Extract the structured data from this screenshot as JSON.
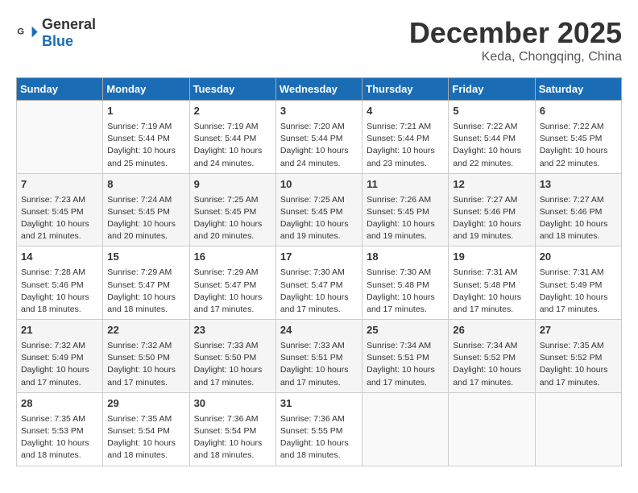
{
  "header": {
    "logo_general": "General",
    "logo_blue": "Blue",
    "month": "December 2025",
    "location": "Keda, Chongqing, China"
  },
  "columns": [
    "Sunday",
    "Monday",
    "Tuesday",
    "Wednesday",
    "Thursday",
    "Friday",
    "Saturday"
  ],
  "weeks": [
    [
      {
        "day": "",
        "info": ""
      },
      {
        "day": "1",
        "info": "Sunrise: 7:19 AM\nSunset: 5:44 PM\nDaylight: 10 hours\nand 25 minutes."
      },
      {
        "day": "2",
        "info": "Sunrise: 7:19 AM\nSunset: 5:44 PM\nDaylight: 10 hours\nand 24 minutes."
      },
      {
        "day": "3",
        "info": "Sunrise: 7:20 AM\nSunset: 5:44 PM\nDaylight: 10 hours\nand 24 minutes."
      },
      {
        "day": "4",
        "info": "Sunrise: 7:21 AM\nSunset: 5:44 PM\nDaylight: 10 hours\nand 23 minutes."
      },
      {
        "day": "5",
        "info": "Sunrise: 7:22 AM\nSunset: 5:44 PM\nDaylight: 10 hours\nand 22 minutes."
      },
      {
        "day": "6",
        "info": "Sunrise: 7:22 AM\nSunset: 5:45 PM\nDaylight: 10 hours\nand 22 minutes."
      }
    ],
    [
      {
        "day": "7",
        "info": "Sunrise: 7:23 AM\nSunset: 5:45 PM\nDaylight: 10 hours\nand 21 minutes."
      },
      {
        "day": "8",
        "info": "Sunrise: 7:24 AM\nSunset: 5:45 PM\nDaylight: 10 hours\nand 20 minutes."
      },
      {
        "day": "9",
        "info": "Sunrise: 7:25 AM\nSunset: 5:45 PM\nDaylight: 10 hours\nand 20 minutes."
      },
      {
        "day": "10",
        "info": "Sunrise: 7:25 AM\nSunset: 5:45 PM\nDaylight: 10 hours\nand 19 minutes."
      },
      {
        "day": "11",
        "info": "Sunrise: 7:26 AM\nSunset: 5:45 PM\nDaylight: 10 hours\nand 19 minutes."
      },
      {
        "day": "12",
        "info": "Sunrise: 7:27 AM\nSunset: 5:46 PM\nDaylight: 10 hours\nand 19 minutes."
      },
      {
        "day": "13",
        "info": "Sunrise: 7:27 AM\nSunset: 5:46 PM\nDaylight: 10 hours\nand 18 minutes."
      }
    ],
    [
      {
        "day": "14",
        "info": "Sunrise: 7:28 AM\nSunset: 5:46 PM\nDaylight: 10 hours\nand 18 minutes."
      },
      {
        "day": "15",
        "info": "Sunrise: 7:29 AM\nSunset: 5:47 PM\nDaylight: 10 hours\nand 18 minutes."
      },
      {
        "day": "16",
        "info": "Sunrise: 7:29 AM\nSunset: 5:47 PM\nDaylight: 10 hours\nand 17 minutes."
      },
      {
        "day": "17",
        "info": "Sunrise: 7:30 AM\nSunset: 5:47 PM\nDaylight: 10 hours\nand 17 minutes."
      },
      {
        "day": "18",
        "info": "Sunrise: 7:30 AM\nSunset: 5:48 PM\nDaylight: 10 hours\nand 17 minutes."
      },
      {
        "day": "19",
        "info": "Sunrise: 7:31 AM\nSunset: 5:48 PM\nDaylight: 10 hours\nand 17 minutes."
      },
      {
        "day": "20",
        "info": "Sunrise: 7:31 AM\nSunset: 5:49 PM\nDaylight: 10 hours\nand 17 minutes."
      }
    ],
    [
      {
        "day": "21",
        "info": "Sunrise: 7:32 AM\nSunset: 5:49 PM\nDaylight: 10 hours\nand 17 minutes."
      },
      {
        "day": "22",
        "info": "Sunrise: 7:32 AM\nSunset: 5:50 PM\nDaylight: 10 hours\nand 17 minutes."
      },
      {
        "day": "23",
        "info": "Sunrise: 7:33 AM\nSunset: 5:50 PM\nDaylight: 10 hours\nand 17 minutes."
      },
      {
        "day": "24",
        "info": "Sunrise: 7:33 AM\nSunset: 5:51 PM\nDaylight: 10 hours\nand 17 minutes."
      },
      {
        "day": "25",
        "info": "Sunrise: 7:34 AM\nSunset: 5:51 PM\nDaylight: 10 hours\nand 17 minutes."
      },
      {
        "day": "26",
        "info": "Sunrise: 7:34 AM\nSunset: 5:52 PM\nDaylight: 10 hours\nand 17 minutes."
      },
      {
        "day": "27",
        "info": "Sunrise: 7:35 AM\nSunset: 5:52 PM\nDaylight: 10 hours\nand 17 minutes."
      }
    ],
    [
      {
        "day": "28",
        "info": "Sunrise: 7:35 AM\nSunset: 5:53 PM\nDaylight: 10 hours\nand 18 minutes."
      },
      {
        "day": "29",
        "info": "Sunrise: 7:35 AM\nSunset: 5:54 PM\nDaylight: 10 hours\nand 18 minutes."
      },
      {
        "day": "30",
        "info": "Sunrise: 7:36 AM\nSunset: 5:54 PM\nDaylight: 10 hours\nand 18 minutes."
      },
      {
        "day": "31",
        "info": "Sunrise: 7:36 AM\nSunset: 5:55 PM\nDaylight: 10 hours\nand 18 minutes."
      },
      {
        "day": "",
        "info": ""
      },
      {
        "day": "",
        "info": ""
      },
      {
        "day": "",
        "info": ""
      }
    ]
  ]
}
